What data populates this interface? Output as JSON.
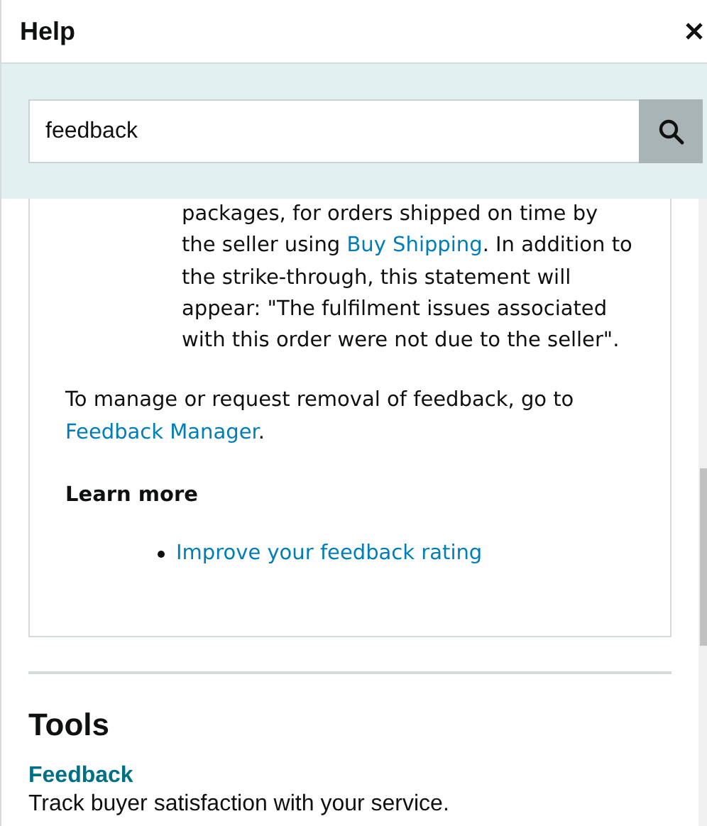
{
  "header": {
    "title": "Help"
  },
  "search": {
    "value": "feedback"
  },
  "article": {
    "bullet_parts": [
      {
        "kind": "text",
        "text": "packages, for orders shipped on time by the seller using "
      },
      {
        "kind": "link",
        "text": "Buy Shipping"
      },
      {
        "kind": "text",
        "text": ". In addition to the strike-through, this statement will appear: \"The fulfilment issues associated with this order were not due to the seller\"."
      }
    ],
    "paragraph_parts": [
      {
        "kind": "text",
        "text": "To manage or request removal of feedback, go to "
      },
      {
        "kind": "link",
        "text": "Feedback Manager"
      },
      {
        "kind": "text",
        "text": "."
      }
    ],
    "learn_more": {
      "heading": "Learn more",
      "links": [
        "Improve your feedback rating"
      ]
    }
  },
  "tools": {
    "heading": "Tools",
    "items": [
      {
        "title": "Feedback",
        "description": "Track buyer satisfaction with your service."
      }
    ]
  }
}
